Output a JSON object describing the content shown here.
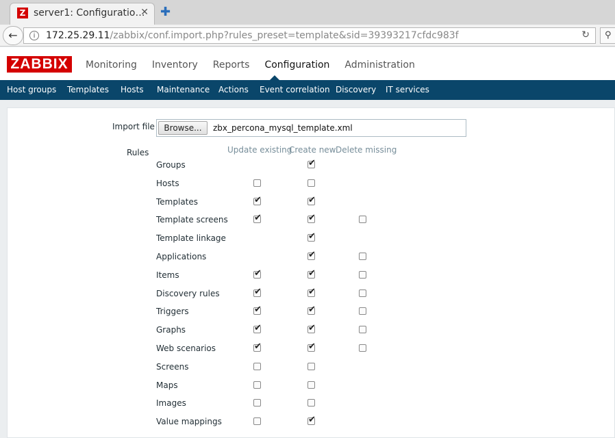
{
  "browser": {
    "tab_title": "server1: Configuratio…",
    "tab_favicon": "Z",
    "url_host": "172.25.29.11",
    "url_path": "/zabbix/conf.import.php?rules_preset=template&sid=39393217cfdc983f"
  },
  "header": {
    "logo": "ZABBIX",
    "menu": [
      "Monitoring",
      "Inventory",
      "Reports",
      "Configuration",
      "Administration"
    ],
    "active_menu": "Configuration"
  },
  "submenu": [
    "Host groups",
    "Templates",
    "Hosts",
    "Maintenance",
    "Actions",
    "Event correlation",
    "Discovery",
    "IT services"
  ],
  "form": {
    "import_file_label": "Import file",
    "browse_label": "Browse...",
    "file_name": "zbx_percona_mysql_template.xml",
    "rules_label": "Rules",
    "columns": [
      "Update existing",
      "Create new",
      "Delete missing"
    ],
    "rules": [
      {
        "name": "Groups",
        "update": null,
        "create": true,
        "delete": null
      },
      {
        "name": "Hosts",
        "update": false,
        "create": false,
        "delete": null
      },
      {
        "name": "Templates",
        "update": true,
        "create": true,
        "delete": null
      },
      {
        "name": "Template screens",
        "update": true,
        "create": true,
        "delete": false
      },
      {
        "name": "Template linkage",
        "update": null,
        "create": true,
        "delete": null
      },
      {
        "name": "Applications",
        "update": null,
        "create": true,
        "delete": false
      },
      {
        "name": "Items",
        "update": true,
        "create": true,
        "delete": false
      },
      {
        "name": "Discovery rules",
        "update": true,
        "create": true,
        "delete": false
      },
      {
        "name": "Triggers",
        "update": true,
        "create": true,
        "delete": false
      },
      {
        "name": "Graphs",
        "update": true,
        "create": true,
        "delete": false
      },
      {
        "name": "Web scenarios",
        "update": true,
        "create": true,
        "delete": false
      },
      {
        "name": "Screens",
        "update": false,
        "create": false,
        "delete": null
      },
      {
        "name": "Maps",
        "update": false,
        "create": false,
        "delete": null
      },
      {
        "name": "Images",
        "update": false,
        "create": false,
        "delete": null
      },
      {
        "name": "Value mappings",
        "update": false,
        "create": true,
        "delete": null
      }
    ]
  },
  "colors": {
    "brand_red": "#d40000",
    "submenu_bg": "#0a466a"
  }
}
